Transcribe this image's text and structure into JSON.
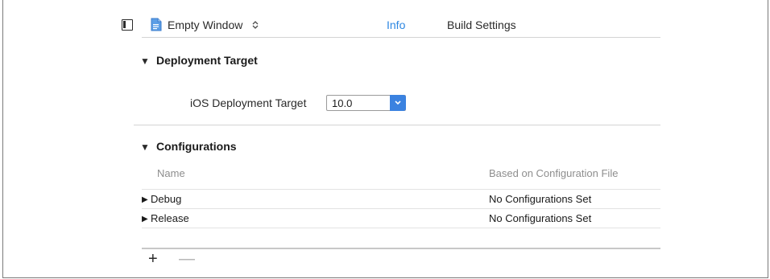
{
  "toolbar": {
    "project_name": "Empty Window",
    "stepper_glyph": "⌃⌄",
    "tabs": [
      {
        "label": "Info",
        "selected": true
      },
      {
        "label": "Build Settings",
        "selected": false
      }
    ]
  },
  "deployment": {
    "title": "Deployment Target",
    "field_label": "iOS Deployment Target",
    "selected_value": "10.0"
  },
  "configurations": {
    "title": "Configurations",
    "columns": [
      "Name",
      "Based on Configuration File"
    ],
    "rows": [
      {
        "name": "Debug",
        "file": "No Configurations Set"
      },
      {
        "name": "Release",
        "file": "No Configurations Set"
      }
    ]
  },
  "footer": {
    "add_label": "+",
    "remove_label": "—"
  },
  "colors": {
    "accent": "#2d87e2",
    "select_arrow": "#3b82e0"
  },
  "icons": [
    "sidebar-toggle-icon",
    "project-file-icon",
    "stepper-icon",
    "disclosure-triangle-icon",
    "popup-arrow-icon",
    "add-icon",
    "remove-icon"
  ]
}
